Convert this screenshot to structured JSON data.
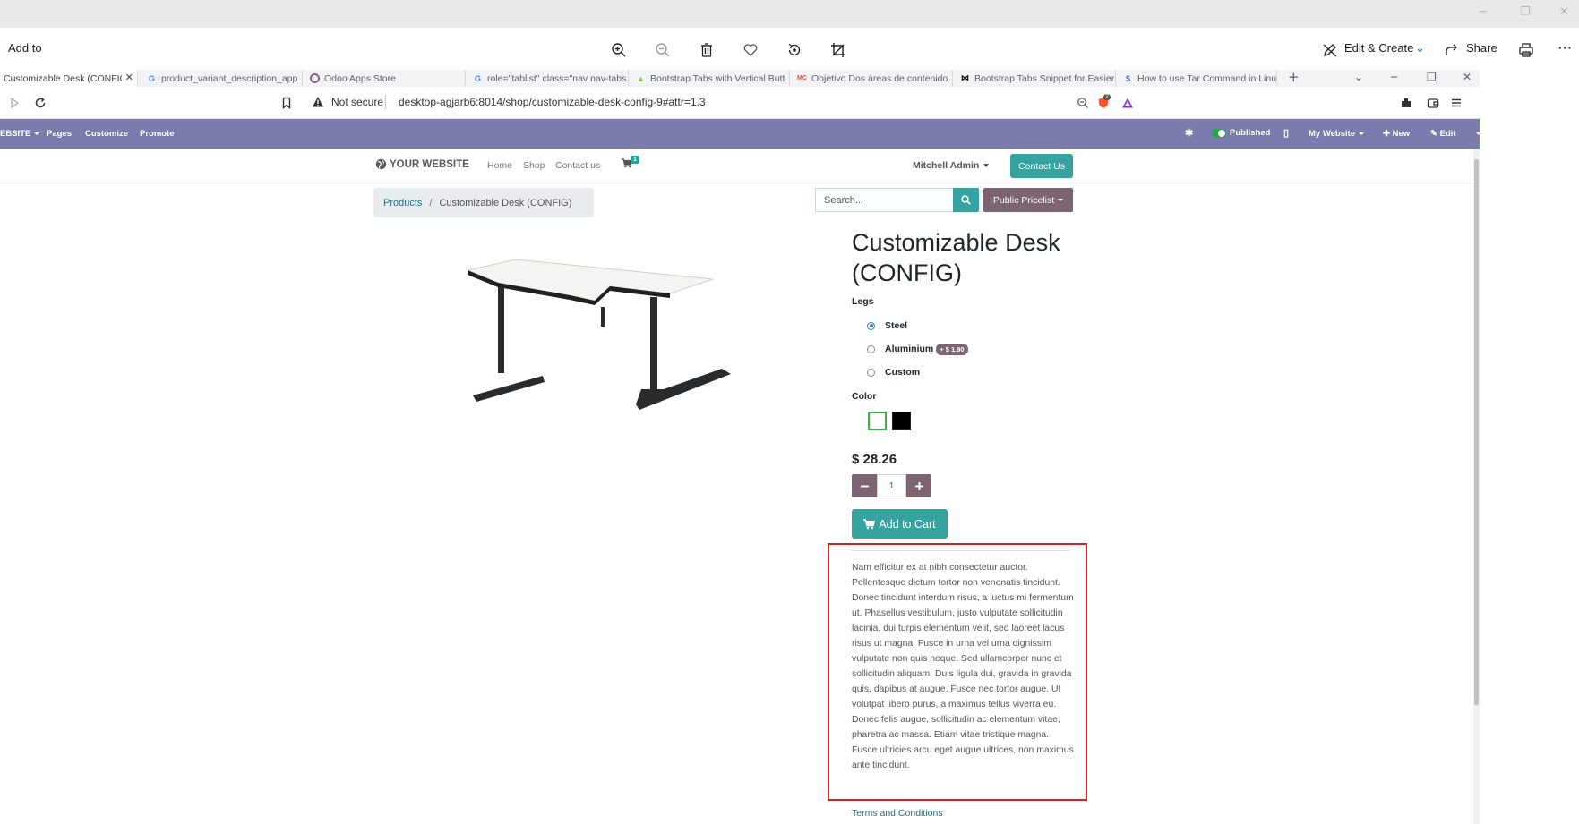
{
  "viewer": {
    "add_to_label": "Add to",
    "edit_create_label": "Edit & Create",
    "share_label": "Share"
  },
  "tabs": [
    {
      "label": "Customizable Desk (CONFIG",
      "favicon": "odoo",
      "active": true
    },
    {
      "label": "product_variant_description_app",
      "favicon": "google"
    },
    {
      "label": "Odoo Apps Store",
      "favicon": "odoo-circle"
    },
    {
      "label": "role=\"tablist\" class=\"nav nav-tabs",
      "favicon": "google"
    },
    {
      "label": "Bootstrap Tabs with Vertical Butt",
      "favicon": "triangle"
    },
    {
      "label": "Objetivo Dos áreas de contenido",
      "favicon": "mc"
    },
    {
      "label": "Bootstrap Tabs Snippet for Easier",
      "favicon": "bowtie"
    },
    {
      "label": "How to use Tar Command in Linu",
      "favicon": "dollar"
    }
  ],
  "address": {
    "not_secure": "Not secure",
    "url": "desktop-agjarb6:8014/shop/customizable-desk-config-9#attr=1,3",
    "brave_badge": "2"
  },
  "admin_bar": {
    "website": "EBSITE",
    "pages": "Pages",
    "customize": "Customize",
    "promote": "Promote",
    "published": "Published",
    "my_website": "My Website",
    "new": "New",
    "edit": "Edit"
  },
  "header": {
    "logo": "YOUR WEBSITE",
    "nav": [
      "Home",
      "Shop",
      "Contact us"
    ],
    "cart_count": "1",
    "user": "Mitchell Admin",
    "contact_button": "Contact Us"
  },
  "breadcrumb": {
    "products": "Products",
    "separator": "/",
    "current": "Customizable Desk (CONFIG)"
  },
  "search": {
    "placeholder": "Search...",
    "pricelist": "Public Pricelist"
  },
  "product": {
    "title": "Customizable Desk (CONFIG)",
    "legs_label": "Legs",
    "legs_options": [
      {
        "label": "Steel",
        "checked": true
      },
      {
        "label": "Aluminium",
        "extra": "+ $ 1.90"
      },
      {
        "label": "Custom"
      }
    ],
    "color_label": "Color",
    "colors": [
      {
        "name": "white",
        "hex": "#ffffff",
        "selected": true
      },
      {
        "name": "black",
        "hex": "#000000"
      }
    ],
    "price": "$ 28.26",
    "quantity": "1",
    "add_to_cart": "Add to Cart",
    "description": "Nam efficitur ex at nibh consectetur auctor. Pellentesque dictum tortor non venenatis tincidunt. Donec tincidunt interdum risus, a luctus mi fermentum ut. Phasellus vestibulum, justo vulputate sollicitudin lacinia, dui turpis elementum velit, sed laoreet lacus risus ut magna. Fusce in urna vel urna dignissim vulputate non quis neque. Sed ullamcorper nunc et sollicitudin aliquam. Duis ligula dui, gravida in gravida quis, dapibus at augue. Fusce nec tortor augue. Ut volutpat libero purus, a maximus tellus viverra eu. Donec felis augue, sollicitudin ac elementum vitae, pharetra ac massa. Etiam vitae tristique magna. Fusce ultricies arcu eget augue ultrices, non maximus ante tincidunt.",
    "terms": "Terms and Conditions"
  },
  "colors": {
    "admin_bar": "#7c7bad",
    "teal_primary": "#35a3a0",
    "secondary": "#7c6472",
    "highlight": "#d62027"
  }
}
